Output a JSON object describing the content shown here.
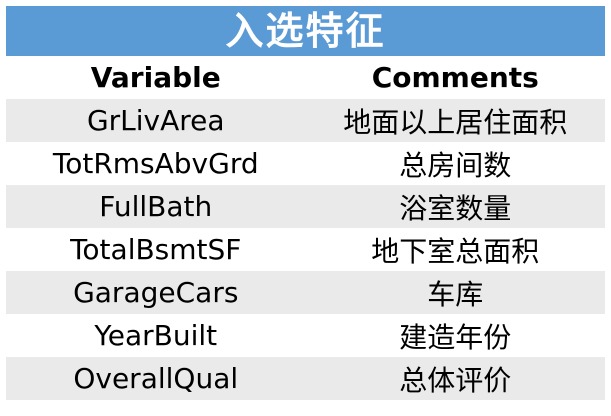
{
  "title": "入选特征",
  "table": {
    "headers": [
      "Variable",
      "Comments"
    ],
    "rows": [
      {
        "variable": "GrLivArea",
        "comment": "地面以上居住面积"
      },
      {
        "variable": "TotRmsAbvGrd",
        "comment": "总房间数"
      },
      {
        "variable": "FullBath",
        "comment": "浴室数量"
      },
      {
        "variable": "TotalBsmtSF",
        "comment": "地下室总面积"
      },
      {
        "variable": "GarageCars",
        "comment": "车库"
      },
      {
        "variable": "YearBuilt",
        "comment": "建造年份"
      },
      {
        "variable": "OverallQual",
        "comment": "总体评价"
      }
    ]
  },
  "colors": {
    "title_bar": "#5b9bd5",
    "title_text": "#ffffff",
    "row_band": "#eaeaea"
  }
}
